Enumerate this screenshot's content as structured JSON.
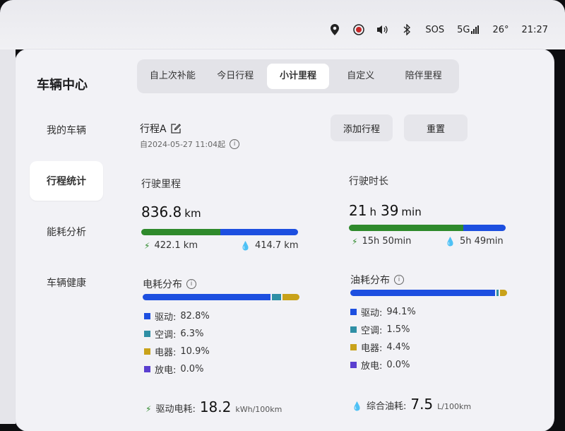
{
  "status": {
    "sos": "SOS",
    "network": "5G",
    "temp": "26°",
    "time": "21:27"
  },
  "sidebar": {
    "title": "车辆中心",
    "items": [
      {
        "label": "我的车辆"
      },
      {
        "label": "行程统计"
      },
      {
        "label": "能耗分析"
      },
      {
        "label": "车辆健康"
      }
    ]
  },
  "tabs": [
    "自上次补能",
    "今日行程",
    "小计里程",
    "自定义",
    "陪伴里程"
  ],
  "trip": {
    "name": "行程A",
    "since": "自2024-05-27 11:04起",
    "add_button": "添加行程",
    "reset_button": "重置"
  },
  "distance": {
    "label": "行驶里程",
    "value": "836.8",
    "unit": "km",
    "electric": "422.1 km",
    "fuel": "414.7 km",
    "electric_fraction": 0.504
  },
  "duration": {
    "label": "行驶时长",
    "hours": "21",
    "h_unit": "h",
    "minutes": "39",
    "m_unit": "min",
    "electric": "15h 50min",
    "fuel": "5h 49min",
    "electric_fraction": 0.731
  },
  "electric_dist": {
    "label": "电耗分布",
    "items": [
      {
        "label": "驱动:",
        "value": "82.8%",
        "pct": 82.8,
        "color": "#1d4fe0"
      },
      {
        "label": "空调:",
        "value": "6.3%",
        "pct": 6.3,
        "color": "#2f8fa5"
      },
      {
        "label": "电器:",
        "value": "10.9%",
        "pct": 10.9,
        "color": "#c9a21a"
      },
      {
        "label": "放电:",
        "value": "0.0%",
        "pct": 0.0,
        "color": "#5a3fd0"
      }
    ],
    "bottom_label": "驱动电耗:",
    "bottom_value": "18.2",
    "bottom_unit": "kWh/100km"
  },
  "fuel_dist": {
    "label": "油耗分布",
    "items": [
      {
        "label": "驱动:",
        "value": "94.1%",
        "pct": 94.1,
        "color": "#1d4fe0"
      },
      {
        "label": "空调:",
        "value": "1.5%",
        "pct": 1.5,
        "color": "#2f8fa5"
      },
      {
        "label": "电器:",
        "value": "4.4%",
        "pct": 4.4,
        "color": "#c9a21a"
      },
      {
        "label": "放电:",
        "value": "0.0%",
        "pct": 0.0,
        "color": "#5a3fd0"
      }
    ],
    "bottom_label": "综合油耗:",
    "bottom_value": "7.5",
    "bottom_unit": "L/100km"
  },
  "colors": {
    "green": "#2f8a2c",
    "blue": "#1d4fe0"
  }
}
